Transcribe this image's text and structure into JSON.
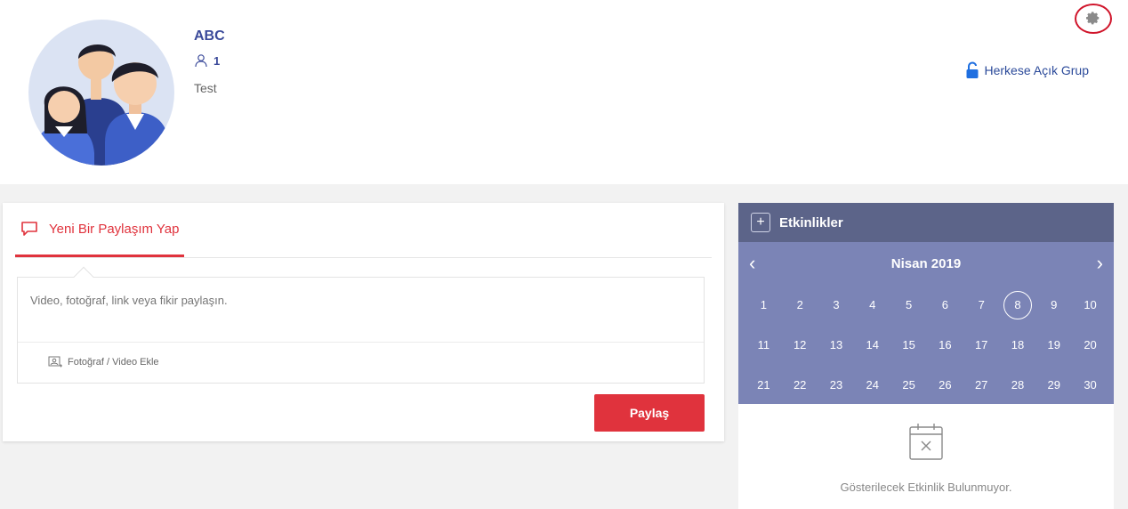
{
  "group": {
    "name": "ABC",
    "member_count": "1",
    "description": "Test",
    "privacy_label": "Herkese Açık Grup"
  },
  "post": {
    "tab_label": "Yeni Bir Paylaşım Yap",
    "placeholder": "Video, fotoğraf, link veya fikir paylaşın.",
    "media_label": "Fotoğraf / Video Ekle",
    "share_label": "Paylaş"
  },
  "events": {
    "title": "Etkinlikler",
    "add_label": "+",
    "month_title": "Nisan 2019",
    "prev_label": "‹",
    "next_label": "›",
    "days": [
      "1",
      "2",
      "3",
      "4",
      "5",
      "6",
      "7",
      "8",
      "9",
      "10",
      "11",
      "12",
      "13",
      "14",
      "15",
      "16",
      "17",
      "18",
      "19",
      "20",
      "21",
      "22",
      "23",
      "24",
      "25",
      "26",
      "27",
      "28",
      "29",
      "30"
    ],
    "today": "8",
    "empty_text": "Gösterilecek Etkinlik Bulunmuyor."
  },
  "colors": {
    "accent": "#e0333d",
    "events_header": "#5c6489",
    "calendar_bg": "#7b84b6",
    "brand_blue": "#3b4a9a"
  },
  "icons": [
    "settings-gear-icon",
    "user-icon",
    "lock-icon",
    "comment-icon",
    "photo-icon",
    "calendar-x-icon"
  ]
}
